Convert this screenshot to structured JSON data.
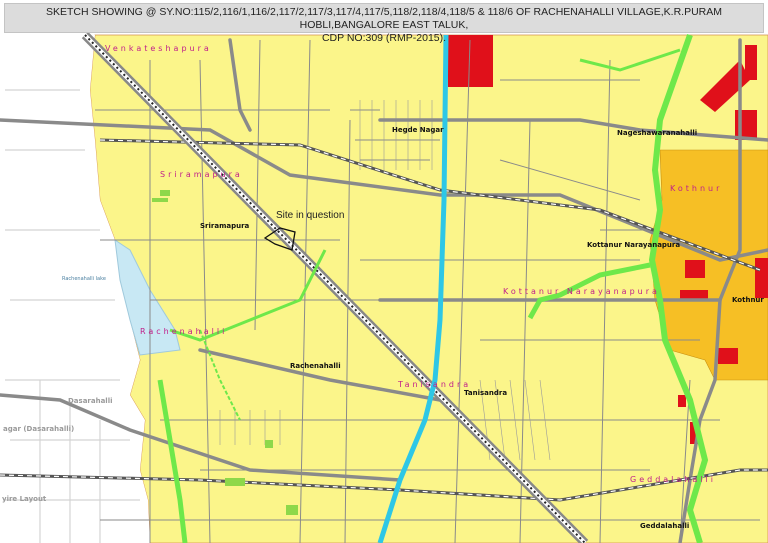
{
  "title": {
    "line1": "SKETCH SHOWING @ SY.NO:115/2,116/1,116/2,117/2,117/3,117/4,117/5,118/2,118/4,118/5 & 118/6 OF RACHENAHALLI VILLAGE,K.R.PURAM HOBLI,BANGALORE EAST TALUK,",
    "line2": "CDP NO:309 (RMP-2015)."
  },
  "labels": {
    "site": "Site in question",
    "venkateshapura_area": "Venkateshapura",
    "sriramapura_area": "Sriramapura",
    "sriramapura": "Sriramapura",
    "rachenahalli_area": "Rachenahalli",
    "rachenahalli": "Rachenahalli",
    "hegde_nagar": "Hegde Nagar",
    "nageshawaranahalli": "Nageshawaranahalli",
    "kothnur_area": "Kothnur",
    "kothnur": "Kothnur",
    "kottanur_narayanapura": "Kottanur Narayanapura",
    "kottanur_narayanapura_area": "Kottanur Narayanapura",
    "tanisandra_area": "Tanisandra",
    "tanisandra": "Tanisandra",
    "geddalahalli_area": "Geddalahalli",
    "geddalahalli": "Geddalahalli",
    "dasarahalli": "Dasarahalli",
    "dasarahalli_nagar": "agar (Dasarahalli)",
    "layout": "yire Layout",
    "lake": "Rachenahalli lake"
  },
  "colors": {
    "residential": "#fbf58a",
    "commercial": "#f6bf25",
    "public": "#e0101a",
    "park": "#6ee84a",
    "water": "#2ec7e6",
    "lake": "#c8e8f4",
    "road": "#8a8a8a"
  }
}
